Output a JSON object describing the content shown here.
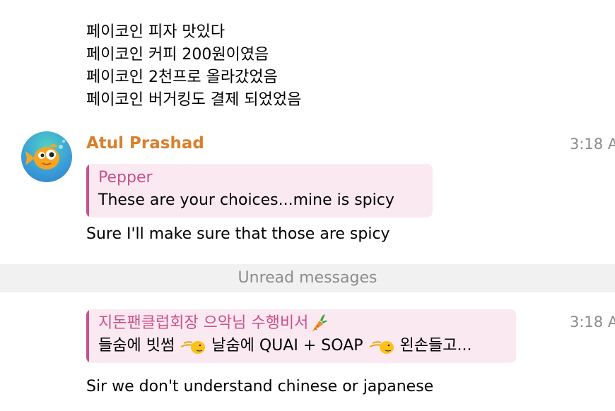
{
  "colors": {
    "sender_name": "#d9802e",
    "reply_accent": "#c9508a",
    "reply_bg": "#fbe9f1",
    "time": "#8c8c8c",
    "divider_bg": "#f1f1f1"
  },
  "prev_message": {
    "lines": [
      "페이코인 피자 맛있다",
      "페이코인 커피 200원이였음",
      "페이코인 2천프로 올라갔었음",
      "페이코인 버거킹도 결제 되었었음"
    ]
  },
  "message1": {
    "avatar_icon": "fish-avatar-icon",
    "sender": "Atul Prashad",
    "time": "3:18 A",
    "reply": {
      "name": "Pepper",
      "text": "These are your choices...mine is spicy"
    },
    "text": "Sure I'll make sure that those are spicy"
  },
  "divider": {
    "label": "Unread messages"
  },
  "message2": {
    "time": "3:18 A",
    "reply": {
      "name": "지돈팬클럽회장 으악님 수행비서",
      "name_icon": "carrot-icon",
      "text_part1": "들숨에 빗썸",
      "text_part2": "날숨에 QUAI + SOAP",
      "text_part3": "왼손들고...",
      "inline_icon": "waving-hand-icon"
    },
    "text": "Sir we don't understand chinese or japanese"
  }
}
